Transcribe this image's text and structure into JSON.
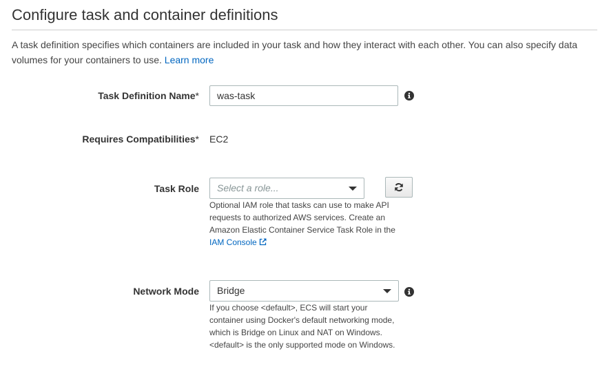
{
  "section": {
    "title": "Configure task and container definitions",
    "description": "A task definition specifies which containers are included in your task and how they interact with each other. You can also specify data volumes for your containers to use.",
    "learn_more": "Learn more"
  },
  "fields": {
    "task_definition_name": {
      "label": "Task Definition Name",
      "required_mark": "*",
      "value": "was-task"
    },
    "requires_compatibilities": {
      "label": "Requires Compatibilities",
      "required_mark": "*",
      "value": "EC2"
    },
    "task_role": {
      "label": "Task Role",
      "placeholder": "Select a role...",
      "help_text": "Optional IAM role that tasks can use to make API requests to authorized AWS services. Create an Amazon Elastic Container Service Task Role in the",
      "help_link": "IAM Console"
    },
    "network_mode": {
      "label": "Network Mode",
      "value": "Bridge",
      "help_text": "If you choose <default>, ECS will start your container using Docker's default networking mode, which is Bridge on Linux and NAT on Windows. <default> is the only supported mode on Windows."
    }
  },
  "icons": {
    "info": "info-circle-icon",
    "refresh": "refresh-icon",
    "external_link": "external-link-icon",
    "dropdown": "caret-down-icon"
  },
  "colors": {
    "link": "#0066c0",
    "border": "#aab7b8",
    "text": "#444444"
  }
}
